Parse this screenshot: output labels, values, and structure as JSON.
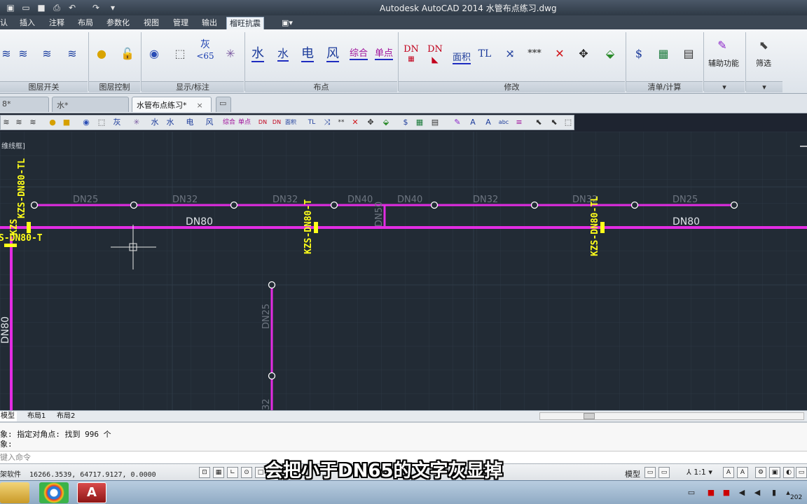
{
  "window": {
    "title": "Autodesk AutoCAD 2014    水管布点练习.dwg"
  },
  "menu": {
    "tabs": [
      "认",
      "插入",
      "注释",
      "布局",
      "参数化",
      "视图",
      "管理",
      "输出",
      "榴旺抗震"
    ],
    "active_index": 8
  },
  "ribbon": {
    "groups": [
      {
        "label": "图层开关"
      },
      {
        "label": "图层控制"
      },
      {
        "label": "显示/标注"
      },
      {
        "label": "布点"
      },
      {
        "label": "修改"
      },
      {
        "label": "清单/计算"
      }
    ],
    "icon_text": {
      "gray": "灰",
      "lt65": "<65",
      "water": "水",
      "electric": "电",
      "wind": "风",
      "combined": "综合",
      "single": "单点",
      "dn": "DN",
      "area": "面积",
      "tl": "TL",
      "stars": "***"
    },
    "aux_button": "辅助功能",
    "filter_button": "筛选"
  },
  "file_tabs": {
    "tabs": [
      {
        "label": "8*"
      },
      {
        "label": "水*"
      },
      {
        "label": "水管布点练习*"
      }
    ],
    "close": "×"
  },
  "drawing": {
    "view_label": "维线框]",
    "pipe_labels": [
      "DN25",
      "DN32",
      "DN32",
      "DN40",
      "DN40",
      "DN32",
      "DN32",
      "DN25"
    ],
    "main_labels": [
      "DN80",
      "DN80"
    ],
    "vertical_labels": {
      "left": "DN80",
      "branch": "DN25",
      "dn50": "DN50",
      "bottom": "32"
    },
    "yellow_labels": {
      "left_vertical": "KZS-DN80-TL",
      "left_horizontal": "S-DN80-T",
      "mid": "KZS-DN80-T",
      "right": "KZS-DN80-TL",
      "left_small": "KZS"
    }
  },
  "layout_tabs": [
    "模型",
    "布局1",
    "布局2"
  ],
  "command": {
    "line1": "象: 指定对角点: 找到 996 个",
    "line2": "象:",
    "input_placeholder": "键入命令"
  },
  "status": {
    "prefix": "架软件",
    "coords": "16266.3539, 64717.9127, 0.0000",
    "model": "模型",
    "scale": "1:1"
  },
  "subtitle": "会把小于DN65的文字灰显掉",
  "clock": {
    "year": "202"
  }
}
